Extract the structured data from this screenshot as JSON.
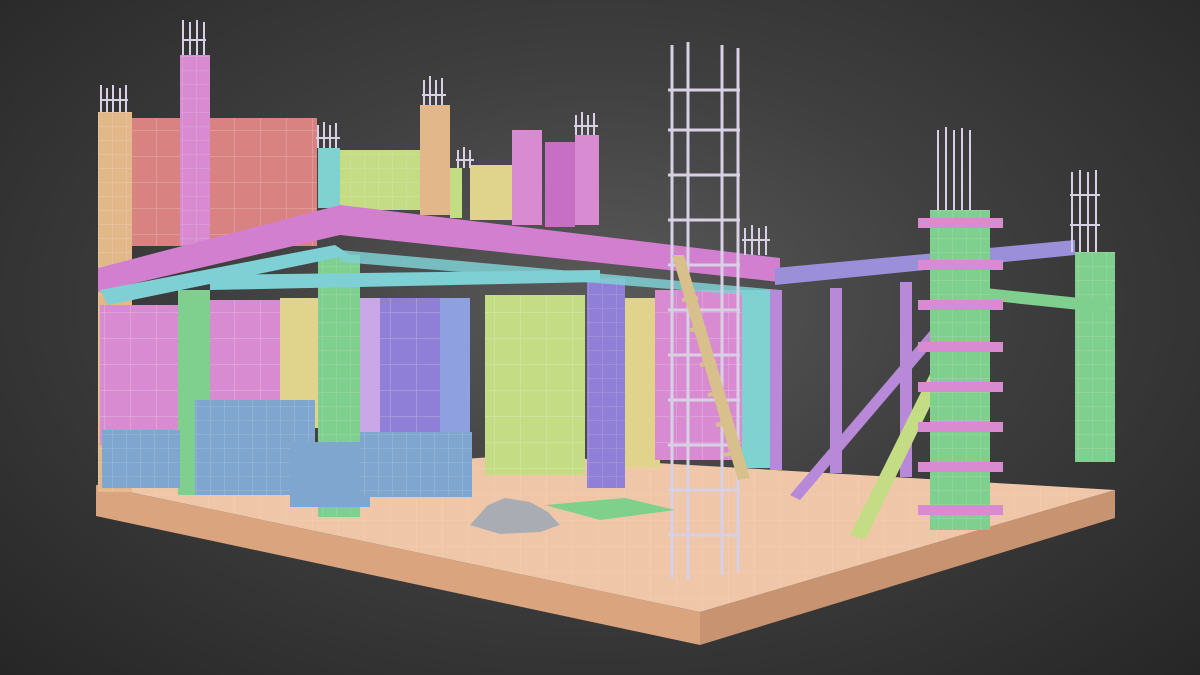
{
  "scene": {
    "subject": "",
    "palette": {
      "background_center": "#5a5a5a",
      "background_edge": "#262626",
      "base_slab_top": "#efc7a8",
      "base_slab_side": "#d9a47e",
      "wall_red": "#d98282",
      "wall_pink": "#d88bd0",
      "wall_magenta": "#c76fc4",
      "wall_orange": "#e2b88a",
      "wall_lime": "#c4dc84",
      "wall_yellow": "#e0d48c",
      "wall_purple": "#8f7fd6",
      "wall_blue": "#7fa6cf",
      "column_green": "#7fcf8f",
      "column_teal": "#7fd2cf",
      "beam_magenta": "#d37fcf",
      "beam_cyan": "#7fd0d4",
      "rebar_grey": "#d8d0e4",
      "scaffold_violet": "#b889d8",
      "ladder_tan": "#d8c08c",
      "rubble_grey": "#a9adb3",
      "floor_mat_green": "#7ed08a"
    }
  }
}
